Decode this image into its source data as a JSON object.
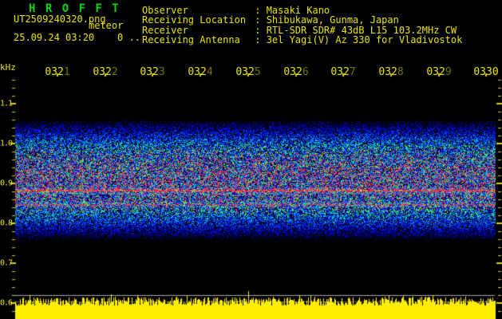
{
  "app_title": "H R O F F T",
  "file_label": "UT2509240320.png",
  "overlay_label": "meteor",
  "datetime_label": "25.09.24 03:20    0 ..",
  "station_info": {
    "separator": " : ",
    "rows": [
      {
        "label": "Observer",
        "value": "Masaki Kano"
      },
      {
        "label": "Receiving Location",
        "value": "Shibukawa, Gunma, Japan"
      },
      {
        "label": "Receiver",
        "value": "RTL-SDR SDR# 43dB L15 103.2MHz CW"
      },
      {
        "label": "Receiving Antenna",
        "value": "3el Yagi(V) Az 330 for Vladivostok"
      }
    ]
  },
  "chart_data": {
    "type": "heatmap",
    "title": "HRO FFT spectrogram, 10-minute waterfall 03:20-03:30 UT, 2025-09-24",
    "x_axis": {
      "labels": [
        "0321",
        "0322",
        "0323",
        "0324",
        "0325",
        "0326",
        "0327",
        "0328",
        "0329",
        "0330"
      ],
      "unit": "UT hhmm"
    },
    "y_axis": {
      "title": "kHz",
      "labels": [
        "1.1",
        "1.0",
        "0.9",
        "0.8",
        "0.7",
        "0.6"
      ],
      "range_khz": [
        0.55,
        1.17
      ]
    },
    "noise_band_khz": [
      0.755,
      1.065
    ],
    "carrier_lines": [
      {
        "khz": 0.882,
        "strength": "strong"
      },
      {
        "khz": 0.848,
        "strength": "weak"
      }
    ],
    "meteor_streaks": [
      {
        "minute": 0.68,
        "khz_top": 0.944,
        "khz_bottom": 0.882
      },
      {
        "minute": 1.85,
        "khz_top": 0.934,
        "khz_bottom": 0.88
      },
      {
        "minute": 3.98,
        "khz_top": 0.954,
        "khz_bottom": 0.878
      },
      {
        "minute": 4.35,
        "khz_top": 0.916,
        "khz_bottom": 0.874
      },
      {
        "minute": 7.4,
        "khz_top": 0.91,
        "khz_bottom": 0.88
      }
    ],
    "bottom_graph": {
      "kind": "signal-strength strip, noisy baseline with spikes",
      "reference_line_khz_row": "0.66",
      "color": "#ffee00"
    },
    "colors": {
      "text_yellow": "#e9e400",
      "title_green": "#0ad80a",
      "tick_yellow": "#d8d400",
      "noise_palette": [
        "#00006a",
        "#0000b8",
        "#0018f0",
        "#0050ff",
        "#00a0ff",
        "#00e0d0",
        "#20ff70",
        "#9af020",
        "#ff4060"
      ],
      "carrier_red": "#ff1a4a",
      "carrier_orange": "#ff6a20",
      "carrier_yellow": "#ffd400",
      "halo_green": "#2aff70",
      "graph_yellow": "#ffee00",
      "ref_gray": "#a8a8a8",
      "ref_gray_dim": "#5c5c5c",
      "background": "#000000"
    },
    "seed": 20250924
  }
}
